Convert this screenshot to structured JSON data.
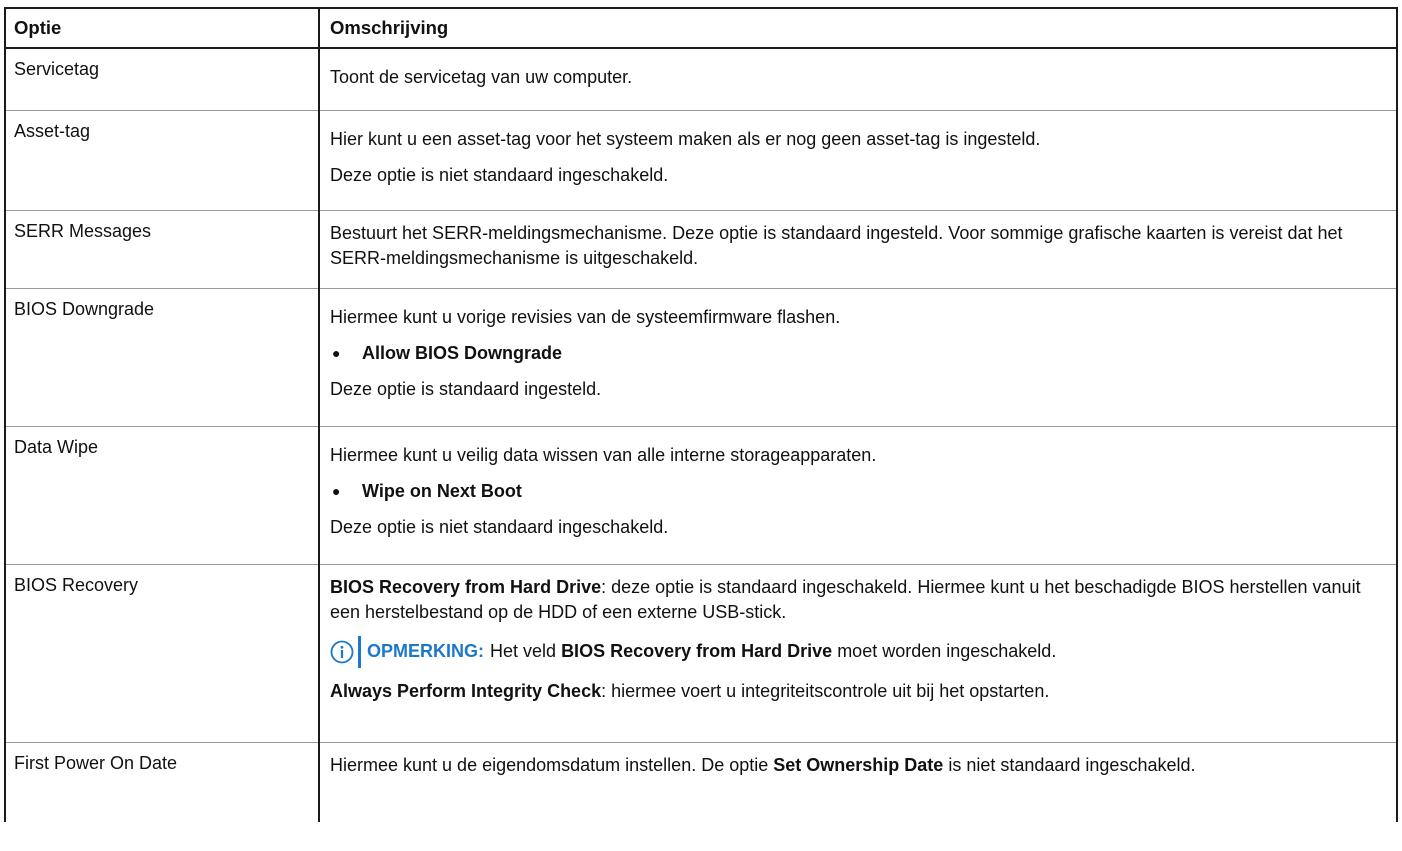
{
  "table": {
    "headers": [
      "Optie",
      "Omschrijving"
    ],
    "rows": [
      {
        "option": "Servicetag",
        "p1": "Toont de servicetag van uw computer."
      },
      {
        "option": "Asset-tag",
        "p1": "Hier kunt u een asset-tag voor het systeem maken als er nog geen asset-tag is ingesteld.",
        "p2": "Deze optie is niet standaard ingeschakeld."
      },
      {
        "option": "SERR Messages",
        "p1": "Bestuurt het SERR-meldingsmechanisme. Deze optie is standaard ingesteld. Voor sommige grafische kaarten is vereist dat het SERR-meldingsmechanisme is uitgeschakeld."
      },
      {
        "option": "BIOS Downgrade",
        "p1": "Hiermee kunt u vorige revisies van de systeemfirmware flashen.",
        "bullet": "Allow BIOS Downgrade",
        "p2": "Deze optie is standaard ingesteld."
      },
      {
        "option": "Data Wipe",
        "p1": "Hiermee kunt u veilig data wissen van alle interne storageapparaten.",
        "bullet": "Wipe on Next Boot",
        "p2": "Deze optie is niet standaard ingeschakeld."
      },
      {
        "option": "BIOS Recovery",
        "p1_bold": "BIOS Recovery from Hard Drive",
        "p1_rest": ": deze optie is standaard ingeschakeld. Hiermee kunt u het beschadigde BIOS herstellen vanuit een herstelbestand op de HDD of een externe USB-stick.",
        "note_label": "OPMERKING:",
        "note_pre": "Het veld",
        "note_bold": "BIOS Recovery from Hard Drive",
        "note_post": "moet worden ingeschakeld.",
        "p2_bold": "Always Perform Integrity Check",
        "p2_rest": ": hiermee voert u integriteitscontrole uit bij het opstarten."
      },
      {
        "option": "First Power On Date",
        "p1_pre": "Hiermee kunt u de eigendomsdatum instellen. De optie",
        "p1_bold": "Set Ownership Date",
        "p1_post": "is niet standaard ingeschakeld."
      }
    ]
  },
  "colors": {
    "note_accent": "#1c78c8",
    "border": "#1a1a1a",
    "divider": "#9a9a9a"
  }
}
